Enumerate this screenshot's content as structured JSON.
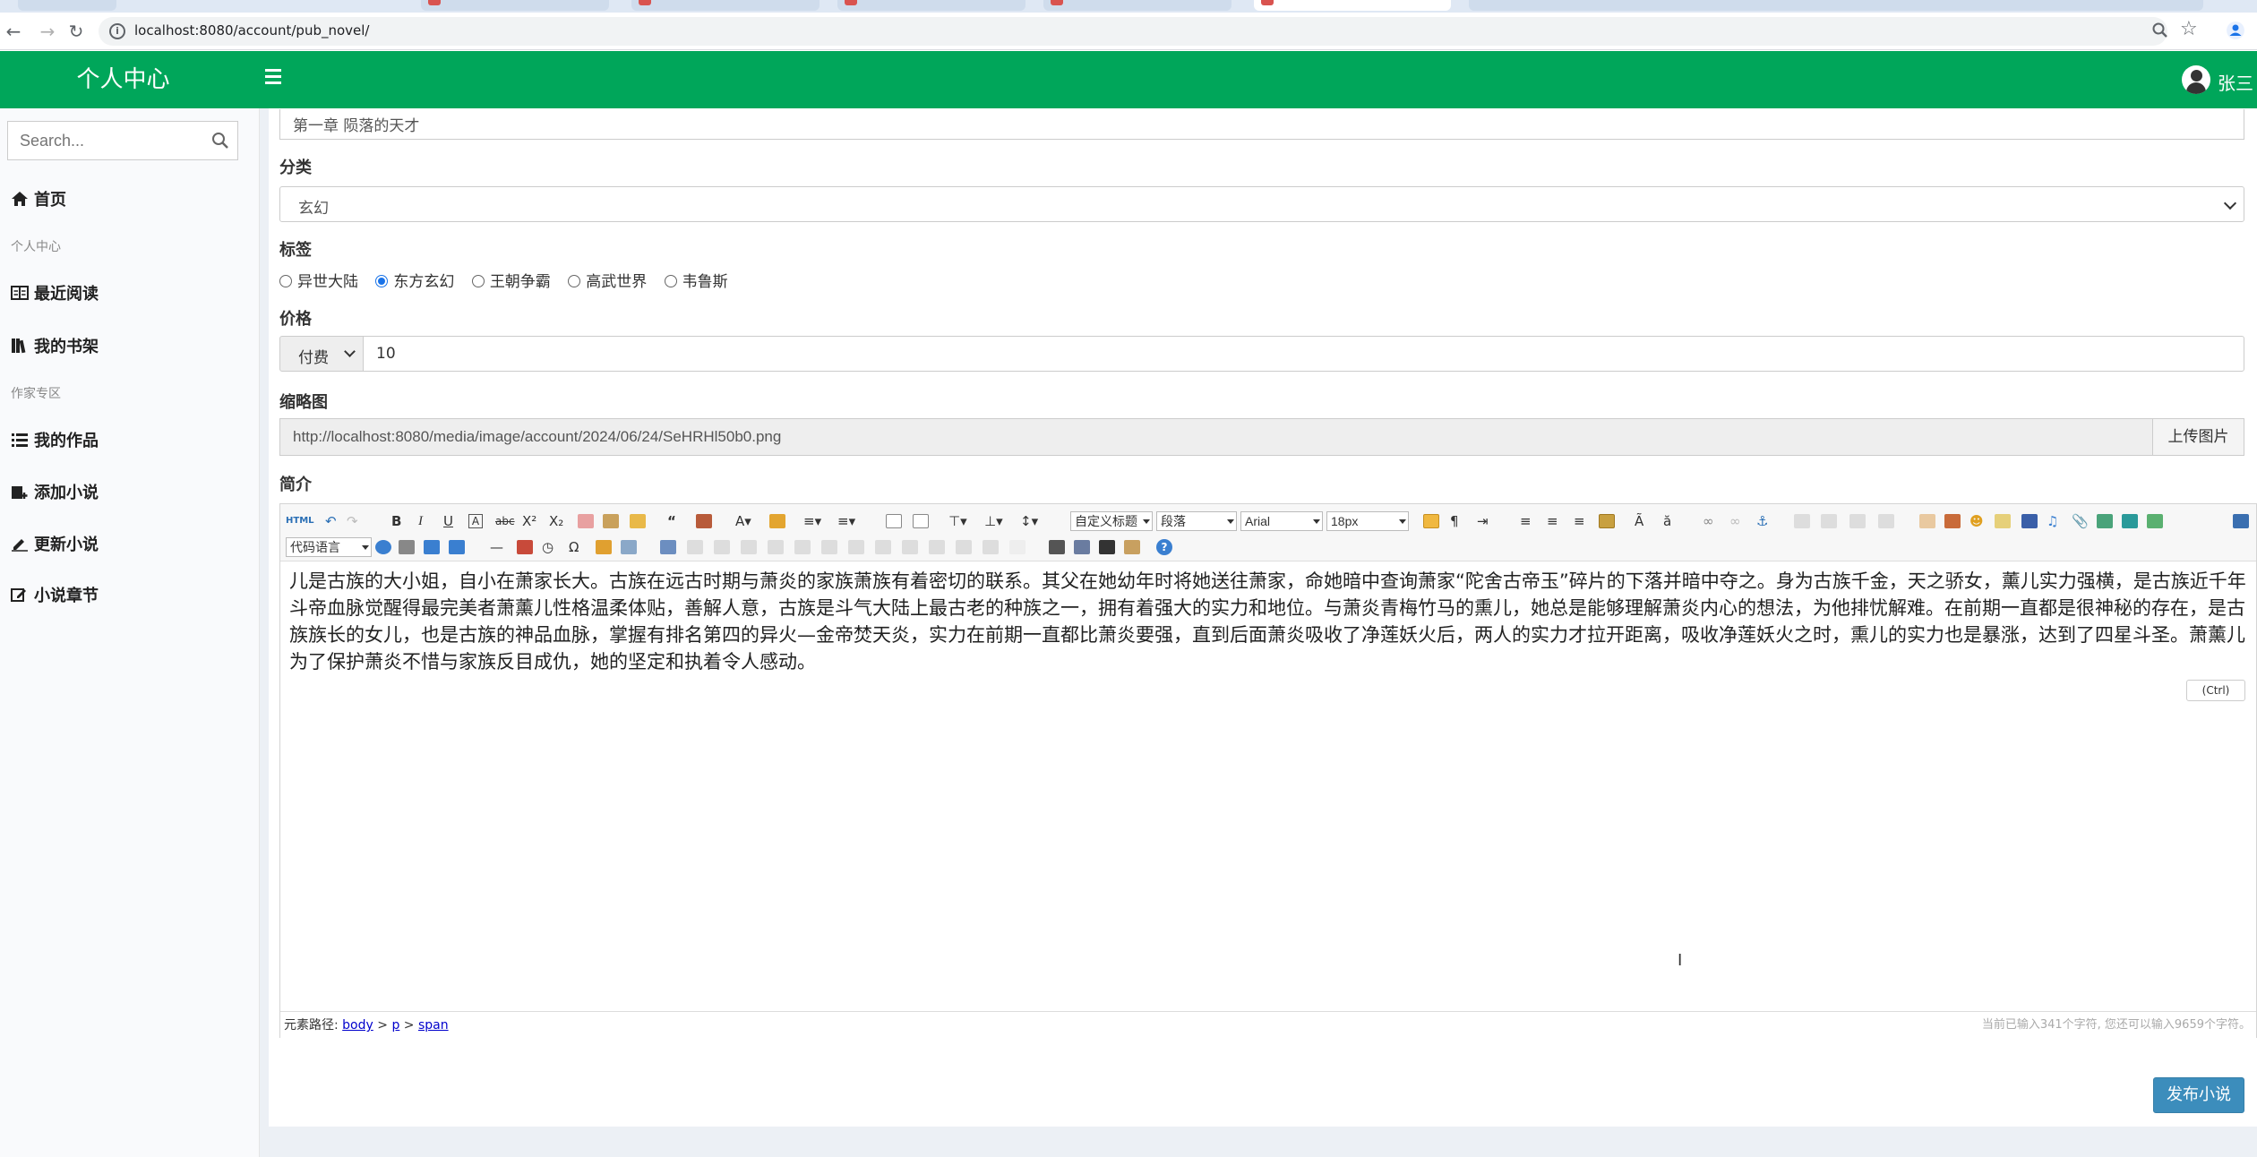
{
  "browser": {
    "url": "localhost:8080/account/pub_novel/"
  },
  "header": {
    "brand": "个人中心",
    "user_name": "张三"
  },
  "sidebar": {
    "search_placeholder": "Search...",
    "home": "首页",
    "section_personal": "个人中心",
    "recent": "最近阅读",
    "bookshelf": "我的书架",
    "section_author": "作家专区",
    "my_works": "我的作品",
    "add_novel": "添加小说",
    "update_novel": "更新小说",
    "chapters": "小说章节"
  },
  "form": {
    "chapter_title_value": "第一章 陨落的天才",
    "category_label": "分类",
    "category_value": "玄幻",
    "tags_label": "标签",
    "tags": [
      {
        "label": "异世大陆",
        "checked": false
      },
      {
        "label": "东方玄幻",
        "checked": true
      },
      {
        "label": "王朝争霸",
        "checked": false
      },
      {
        "label": "高武世界",
        "checked": false
      },
      {
        "label": "韦鲁斯",
        "checked": false
      }
    ],
    "price_label": "价格",
    "price_type": "付费",
    "price_value": "10",
    "thumb_label": "缩略图",
    "thumb_value": "http://localhost:8080/media/image/account/2024/06/24/SeHRHl50b0.png",
    "upload_button": "上传图片",
    "intro_label": "简介",
    "publish_button": "发布小说"
  },
  "editor": {
    "html_button": "HTML",
    "custom_heading": "自定义标题",
    "paragraph": "段落",
    "font_family": "Arial",
    "font_size": "18px",
    "code_language": "代码语言",
    "content": "儿是古族的大小姐，自小在萧家长大。古族在远古时期与萧炎的家族萧族有着密切的联系。其父在她幼年时将她送往萧家，命她暗中查询萧家“陀舍古帝玉”碎片的下落并暗中夺之。身为古族千金，天之骄女，薰儿实力强横，是古族近千年斗帝血脉觉醒得最完美者萧薰儿性格温柔体贴，善解人意，古族是斗气大陆上最古老的种族之一，拥有着强大的实力和地位。与萧炎青梅竹马的熏儿，她总是能够理解萧炎内心的想法，为他排忧解难。在前期一直都是很神秘的存在，是古族族长的女儿，也是古族的神品血脉，掌握有排名第四的异火—金帝焚天炎，实力在前期一直都比萧炎要强，直到后面萧炎吸收了净莲妖火后，两人的实力才拉开距离，吸收净莲妖火之时，熏儿的实力也是暴涨，达到了四星斗圣。萧薰儿为了保护萧炎不惜与家族反目成仇，她的坚定和执着令人感动。",
    "paste_tip": "(Ctrl)",
    "path_label": "元素路径:",
    "path_body": "body",
    "path_p": "p",
    "path_span": "span",
    "count_tip": "当前已输入341个字符, 您还可以输入9659个字符。"
  },
  "colors": {
    "header_green": "#00a65a",
    "publish_blue": "#3c8dbc"
  }
}
